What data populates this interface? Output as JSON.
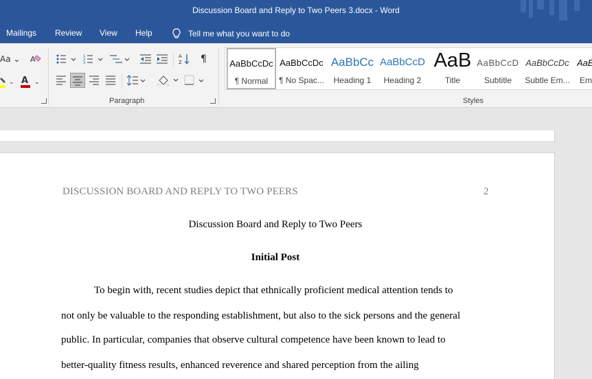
{
  "window": {
    "title": "Discussion Board and Reply to Two Peers 3.docx  -  Word"
  },
  "menu": {
    "tabs": [
      "Mailings",
      "Review",
      "View",
      "Help"
    ],
    "tell_me": "Tell me what you want to do",
    "tell_me_icon": "lightbulb-icon"
  },
  "ribbon": {
    "font_group_fragment": "Aa",
    "paragraph_label": "Paragraph",
    "styles_label": "Styles",
    "font_color": "#c00000",
    "highlight_color": "#ffff00",
    "styles": [
      {
        "sample": "AaBbCcDc",
        "name": "¶ Normal",
        "selected": true
      },
      {
        "sample": "AaBbCcDc",
        "name": "¶ No Spac...",
        "selected": false
      },
      {
        "sample": "AaBbCc",
        "name": "Heading 1",
        "selected": false
      },
      {
        "sample": "AaBbCcD",
        "name": "Heading 2",
        "selected": false
      },
      {
        "sample": "AaB",
        "name": "Title",
        "selected": false
      },
      {
        "sample": "AaBbCcD",
        "name": "Subtitle",
        "selected": false
      },
      {
        "sample": "AaBbCcDc",
        "name": "Subtle Em...",
        "selected": false
      },
      {
        "sample": "AaBl",
        "name": "Em",
        "selected": false
      }
    ]
  },
  "document": {
    "running_head": "DISCUSSION BOARD AND REPLY TO TWO PEERS",
    "page_number": "2",
    "title": "Discussion Board and Reply to Two Peers",
    "heading": "Initial Post",
    "lines": [
      "To begin with, recent studies depict that ethnically proficient medical attention tends to",
      "not only be valuable to the responding establishment, but also to the sick persons and the general",
      "public. In particular, companies that observe cultural competence have been known to lead to",
      "better-quality fitness results, enhanced reverence and shared perception from the ailing"
    ]
  }
}
